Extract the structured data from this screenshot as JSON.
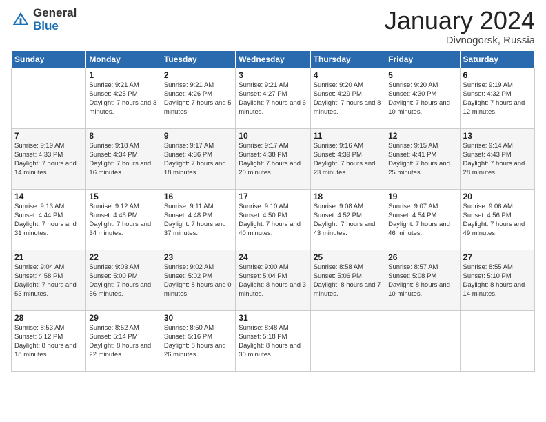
{
  "logo": {
    "general": "General",
    "blue": "Blue"
  },
  "title": "January 2024",
  "location": "Divnogorsk, Russia",
  "days_header": [
    "Sunday",
    "Monday",
    "Tuesday",
    "Wednesday",
    "Thursday",
    "Friday",
    "Saturday"
  ],
  "weeks": [
    [
      {
        "day": "",
        "sunrise": "",
        "sunset": "",
        "daylight": ""
      },
      {
        "day": "1",
        "sunrise": "Sunrise: 9:21 AM",
        "sunset": "Sunset: 4:25 PM",
        "daylight": "Daylight: 7 hours and 3 minutes."
      },
      {
        "day": "2",
        "sunrise": "Sunrise: 9:21 AM",
        "sunset": "Sunset: 4:26 PM",
        "daylight": "Daylight: 7 hours and 5 minutes."
      },
      {
        "day": "3",
        "sunrise": "Sunrise: 9:21 AM",
        "sunset": "Sunset: 4:27 PM",
        "daylight": "Daylight: 7 hours and 6 minutes."
      },
      {
        "day": "4",
        "sunrise": "Sunrise: 9:20 AM",
        "sunset": "Sunset: 4:29 PM",
        "daylight": "Daylight: 7 hours and 8 minutes."
      },
      {
        "day": "5",
        "sunrise": "Sunrise: 9:20 AM",
        "sunset": "Sunset: 4:30 PM",
        "daylight": "Daylight: 7 hours and 10 minutes."
      },
      {
        "day": "6",
        "sunrise": "Sunrise: 9:19 AM",
        "sunset": "Sunset: 4:32 PM",
        "daylight": "Daylight: 7 hours and 12 minutes."
      }
    ],
    [
      {
        "day": "7",
        "sunrise": "Sunrise: 9:19 AM",
        "sunset": "Sunset: 4:33 PM",
        "daylight": "Daylight: 7 hours and 14 minutes."
      },
      {
        "day": "8",
        "sunrise": "Sunrise: 9:18 AM",
        "sunset": "Sunset: 4:34 PM",
        "daylight": "Daylight: 7 hours and 16 minutes."
      },
      {
        "day": "9",
        "sunrise": "Sunrise: 9:17 AM",
        "sunset": "Sunset: 4:36 PM",
        "daylight": "Daylight: 7 hours and 18 minutes."
      },
      {
        "day": "10",
        "sunrise": "Sunrise: 9:17 AM",
        "sunset": "Sunset: 4:38 PM",
        "daylight": "Daylight: 7 hours and 20 minutes."
      },
      {
        "day": "11",
        "sunrise": "Sunrise: 9:16 AM",
        "sunset": "Sunset: 4:39 PM",
        "daylight": "Daylight: 7 hours and 23 minutes."
      },
      {
        "day": "12",
        "sunrise": "Sunrise: 9:15 AM",
        "sunset": "Sunset: 4:41 PM",
        "daylight": "Daylight: 7 hours and 25 minutes."
      },
      {
        "day": "13",
        "sunrise": "Sunrise: 9:14 AM",
        "sunset": "Sunset: 4:43 PM",
        "daylight": "Daylight: 7 hours and 28 minutes."
      }
    ],
    [
      {
        "day": "14",
        "sunrise": "Sunrise: 9:13 AM",
        "sunset": "Sunset: 4:44 PM",
        "daylight": "Daylight: 7 hours and 31 minutes."
      },
      {
        "day": "15",
        "sunrise": "Sunrise: 9:12 AM",
        "sunset": "Sunset: 4:46 PM",
        "daylight": "Daylight: 7 hours and 34 minutes."
      },
      {
        "day": "16",
        "sunrise": "Sunrise: 9:11 AM",
        "sunset": "Sunset: 4:48 PM",
        "daylight": "Daylight: 7 hours and 37 minutes."
      },
      {
        "day": "17",
        "sunrise": "Sunrise: 9:10 AM",
        "sunset": "Sunset: 4:50 PM",
        "daylight": "Daylight: 7 hours and 40 minutes."
      },
      {
        "day": "18",
        "sunrise": "Sunrise: 9:08 AM",
        "sunset": "Sunset: 4:52 PM",
        "daylight": "Daylight: 7 hours and 43 minutes."
      },
      {
        "day": "19",
        "sunrise": "Sunrise: 9:07 AM",
        "sunset": "Sunset: 4:54 PM",
        "daylight": "Daylight: 7 hours and 46 minutes."
      },
      {
        "day": "20",
        "sunrise": "Sunrise: 9:06 AM",
        "sunset": "Sunset: 4:56 PM",
        "daylight": "Daylight: 7 hours and 49 minutes."
      }
    ],
    [
      {
        "day": "21",
        "sunrise": "Sunrise: 9:04 AM",
        "sunset": "Sunset: 4:58 PM",
        "daylight": "Daylight: 7 hours and 53 minutes."
      },
      {
        "day": "22",
        "sunrise": "Sunrise: 9:03 AM",
        "sunset": "Sunset: 5:00 PM",
        "daylight": "Daylight: 7 hours and 56 minutes."
      },
      {
        "day": "23",
        "sunrise": "Sunrise: 9:02 AM",
        "sunset": "Sunset: 5:02 PM",
        "daylight": "Daylight: 8 hours and 0 minutes."
      },
      {
        "day": "24",
        "sunrise": "Sunrise: 9:00 AM",
        "sunset": "Sunset: 5:04 PM",
        "daylight": "Daylight: 8 hours and 3 minutes."
      },
      {
        "day": "25",
        "sunrise": "Sunrise: 8:58 AM",
        "sunset": "Sunset: 5:06 PM",
        "daylight": "Daylight: 8 hours and 7 minutes."
      },
      {
        "day": "26",
        "sunrise": "Sunrise: 8:57 AM",
        "sunset": "Sunset: 5:08 PM",
        "daylight": "Daylight: 8 hours and 10 minutes."
      },
      {
        "day": "27",
        "sunrise": "Sunrise: 8:55 AM",
        "sunset": "Sunset: 5:10 PM",
        "daylight": "Daylight: 8 hours and 14 minutes."
      }
    ],
    [
      {
        "day": "28",
        "sunrise": "Sunrise: 8:53 AM",
        "sunset": "Sunset: 5:12 PM",
        "daylight": "Daylight: 8 hours and 18 minutes."
      },
      {
        "day": "29",
        "sunrise": "Sunrise: 8:52 AM",
        "sunset": "Sunset: 5:14 PM",
        "daylight": "Daylight: 8 hours and 22 minutes."
      },
      {
        "day": "30",
        "sunrise": "Sunrise: 8:50 AM",
        "sunset": "Sunset: 5:16 PM",
        "daylight": "Daylight: 8 hours and 26 minutes."
      },
      {
        "day": "31",
        "sunrise": "Sunrise: 8:48 AM",
        "sunset": "Sunset: 5:18 PM",
        "daylight": "Daylight: 8 hours and 30 minutes."
      },
      {
        "day": "",
        "sunrise": "",
        "sunset": "",
        "daylight": ""
      },
      {
        "day": "",
        "sunrise": "",
        "sunset": "",
        "daylight": ""
      },
      {
        "day": "",
        "sunrise": "",
        "sunset": "",
        "daylight": ""
      }
    ]
  ]
}
